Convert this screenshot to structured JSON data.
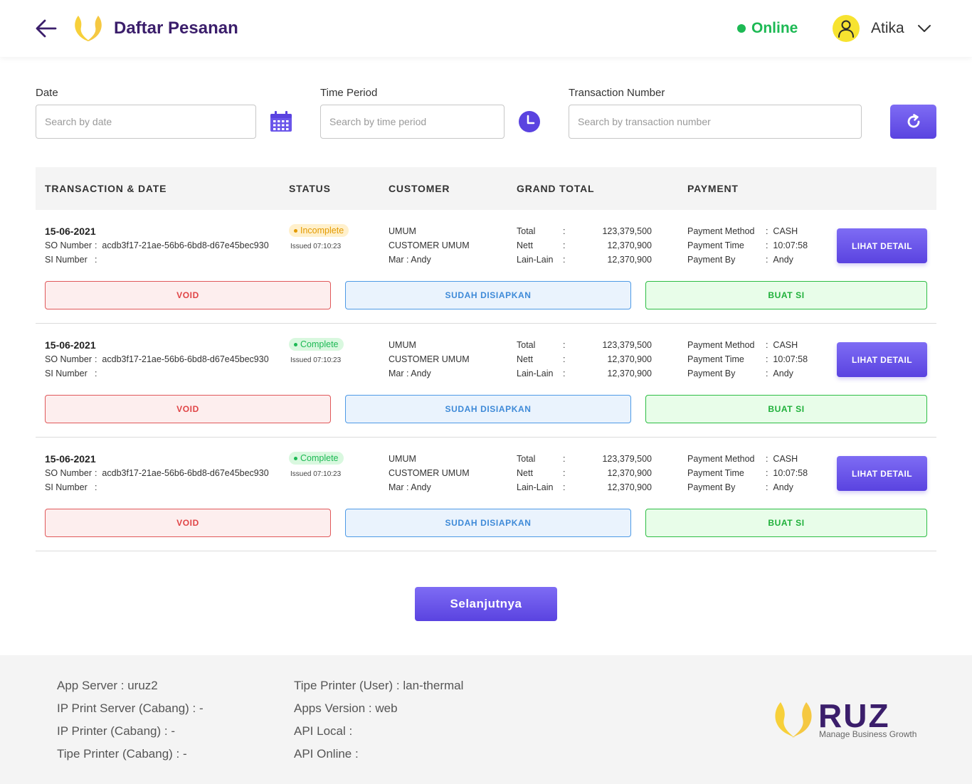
{
  "header": {
    "title": "Daftar Pesanan",
    "status": "Online",
    "user_name": "Atika"
  },
  "filters": {
    "date_label": "Date",
    "date_placeholder": "Search by date",
    "period_label": "Time Period",
    "period_placeholder": "Search by time period",
    "txn_label": "Transaction Number",
    "txn_placeholder": "Search by transaction number"
  },
  "table": {
    "headers": [
      "TRANSACTION & DATE",
      "STATUS",
      "CUSTOMER",
      "GRAND TOTAL",
      "PAYMENT"
    ],
    "labels": {
      "so_number": "SO Number",
      "si_number": "SI Number",
      "total": "Total",
      "nett": "Nett",
      "lain": "Lain-Lain",
      "pay_method": "Payment Method",
      "pay_time": "Payment Time",
      "pay_by": "Payment By",
      "detail_btn": "LIHAT DETAIL",
      "void_btn": "VOID",
      "ready_btn": "SUDAH DISIAPKAN",
      "si_btn": "BUAT SI"
    },
    "rows": [
      {
        "date": "15-06-2021",
        "so_number": "acdb3f17-21ae-56b6-6bd8-d67e45bec930",
        "si_number": "",
        "status": "Incomplete",
        "issued": "Issued 07:10:23",
        "customer_type": "UMUM",
        "customer_name": "CUSTOMER UMUM",
        "customer_mar": "Mar : Andy",
        "total": "123,379,500",
        "nett": "12,370,900",
        "lain": "12,370,900",
        "pay_method": "CASH",
        "pay_time": "10:07:58",
        "pay_by": "Andy"
      },
      {
        "date": "15-06-2021",
        "so_number": "acdb3f17-21ae-56b6-6bd8-d67e45bec930",
        "si_number": "",
        "status": "Complete",
        "issued": "Issued 07:10:23",
        "customer_type": "UMUM",
        "customer_name": "CUSTOMER UMUM",
        "customer_mar": "Mar : Andy",
        "total": "123,379,500",
        "nett": "12,370,900",
        "lain": "12,370,900",
        "pay_method": "CASH",
        "pay_time": "10:07:58",
        "pay_by": "Andy"
      },
      {
        "date": "15-06-2021",
        "so_number": "acdb3f17-21ae-56b6-6bd8-d67e45bec930",
        "si_number": "",
        "status": "Complete",
        "issued": "Issued 07:10:23",
        "customer_type": "UMUM",
        "customer_name": "CUSTOMER UMUM",
        "customer_mar": "Mar : Andy",
        "total": "123,379,500",
        "nett": "12,370,900",
        "lain": "12,370,900",
        "pay_method": "CASH",
        "pay_time": "10:07:58",
        "pay_by": "Andy"
      }
    ]
  },
  "pager": {
    "next_label": "Selanjutnya"
  },
  "footer": {
    "app_server": "App Server : uruz2",
    "ip_print_server": "IP Print Server (Cabang) : -",
    "ip_printer": "IP Printer (Cabang) : -",
    "printer_type_branch": "Tipe Printer (Cabang) : -",
    "printer_type_user": "Tipe Printer (User) : lan-thermal",
    "apps_version": "Apps Version : web",
    "api_local": "API Local :",
    "api_online": "API Online :",
    "brand_name": "RUZ",
    "brand_tagline": "Manage Business Growth"
  },
  "colors": {
    "accent": "#5a43e0",
    "title": "#3b1e6b",
    "online": "#1db954",
    "void": "#e04446",
    "ready": "#3e8ad8",
    "buat_si": "#1fb03a",
    "logo": "#f7d03a"
  },
  "icons": {
    "back": "arrow-left-icon",
    "calendar": "calendar-icon",
    "clock": "clock-icon",
    "refresh": "refresh-icon",
    "user": "user-icon",
    "chevron": "chevron-down-icon"
  }
}
